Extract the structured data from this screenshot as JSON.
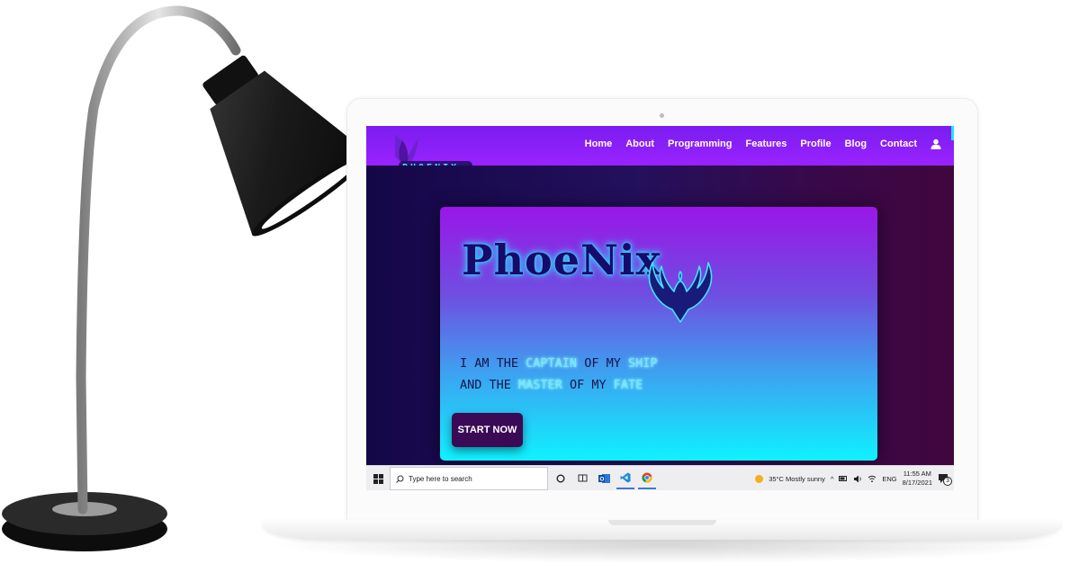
{
  "nav": {
    "brand": "PHOENIX",
    "links": [
      "Home",
      "About",
      "Programming",
      "Features",
      "Profile",
      "Blog",
      "Contact"
    ]
  },
  "hero": {
    "logo_text": "PhoeNix",
    "line1": {
      "a": "I AM THE ",
      "b": "CAPTAIN",
      "c": " OF MY ",
      "d": "SHIP"
    },
    "line2": {
      "a": "AND THE ",
      "b": "MASTER",
      "c": " OF MY ",
      "d": "FATE"
    },
    "cta": "START NOW"
  },
  "taskbar": {
    "search_placeholder": "Type here to search",
    "weather": "35°C  Mostly sunny",
    "lang": "ENG",
    "time": "11:55 AM",
    "date": "8/17/2021",
    "notifications": "3"
  },
  "colors": {
    "nav_bg": "#8a20f8",
    "accent_cyan": "#24e4ff",
    "hero_bg": "#1f0b52",
    "cta_bg": "#3a0a56"
  }
}
